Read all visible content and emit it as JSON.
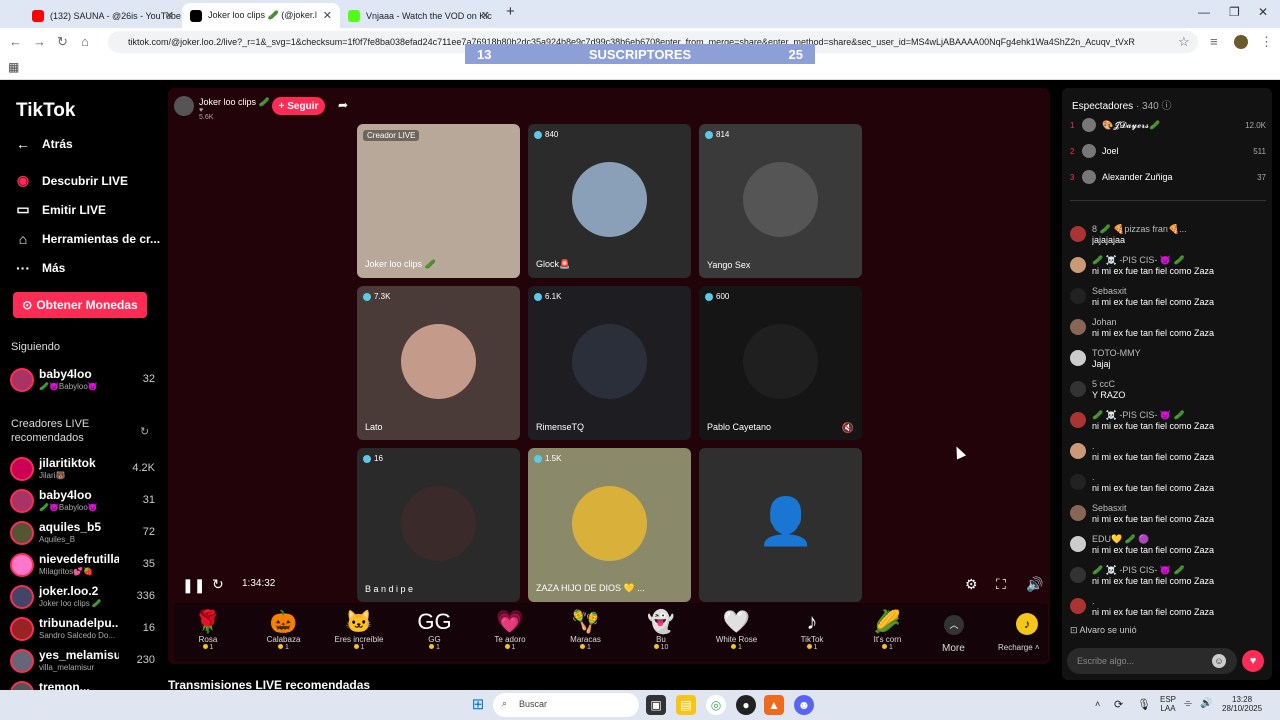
{
  "browser": {
    "tabs": [
      {
        "title": "(132) SAUNA - @26is - YouTube",
        "color": "#ff0000"
      },
      {
        "title": "Joker loo clips 🥒 (@joker.l",
        "color": "#000000"
      },
      {
        "title": "Vnjaaa - Watch the VOD on Kic",
        "color": "#53fc18"
      }
    ],
    "url": "tiktok.com/@joker.loo.2/live?_r=1&_svg=1&checksum=1f0f7fe8ba038efad24c711ee7a76918b80b2dc35a924b8e9c7d99c38b6eb6708enter_from_merge=share&enter_method=share&sec_user_id=MS4wLjABAAAA00NqFg4ehk1Wa4ShZ2n_Acuqv_tVxR"
  },
  "overlay": {
    "left": "13",
    "label": "SUSCRIPTORES",
    "right": "25"
  },
  "sidebar": {
    "logo": "TikTok",
    "nav": [
      {
        "label": "Atrás",
        "icon": "back-arrow-icon"
      },
      {
        "label": "Descubrir LIVE",
        "icon": "live-icon"
      },
      {
        "label": "Emitir LIVE",
        "icon": "camera-icon"
      },
      {
        "label": "Herramientas de cr...",
        "icon": "home-icon"
      },
      {
        "label": "Más",
        "icon": "more-dots-icon"
      }
    ],
    "coins_button": "Obtener Monedas",
    "following_label": "Siguiendo",
    "following": [
      {
        "name": "baby4loo",
        "sub": "🥒😈Babyloo😈",
        "count": "32"
      }
    ],
    "recommended_label": "Creadores LIVE recomendados",
    "recommended": [
      {
        "name": "jilaritiktok",
        "sub": "Jilari🐻",
        "count": "4.2K",
        "color": "#c05"
      },
      {
        "name": "baby4loo",
        "sub": "🥒😈Babyloo😈",
        "count": "31",
        "color": "#a36"
      },
      {
        "name": "aquiles_b5",
        "sub": "Aquiles_B",
        "count": "72",
        "color": "#553"
      },
      {
        "name": "nievedefrutilla",
        "sub": "Milagritos💕🍓",
        "count": "35",
        "color": "#f7c"
      },
      {
        "name": "joker.loo.2",
        "sub": "Joker loo clips 🥒",
        "count": "336",
        "color": "#446"
      },
      {
        "name": "tribunadelpu...",
        "sub": "Sandro Salcedo Do...",
        "count": "16",
        "color": "#922"
      },
      {
        "name": "yes_melamisur",
        "sub": "villa_melamisur",
        "count": "230",
        "color": "#667"
      },
      {
        "name": "tremon...",
        "sub": "",
        "count": "",
        "color": "#555"
      }
    ]
  },
  "host": {
    "name": "Joker loo clips 🥒",
    "likes": "5.6K",
    "follow": "+ Seguir"
  },
  "tiles": [
    {
      "badge": "Creador LIVE",
      "name": "Joker loo clips 🥒",
      "bg": "#b8a89a",
      "circle": ""
    },
    {
      "badge": "840",
      "name": "Glock🚨",
      "bg": "#2b2b2b",
      "circle": "#8aa0b8"
    },
    {
      "badge": "814",
      "name": "Yango Sex",
      "bg": "#3a3a3a",
      "circle": "#555"
    },
    {
      "badge": "7.3K",
      "name": "Lato",
      "bg": "#4a3a38",
      "circle": "#c49a8a"
    },
    {
      "badge": "6.1K",
      "name": "RimenseTQ",
      "bg": "#1e1e22",
      "circle": "#2a2f3a"
    },
    {
      "badge": "600",
      "name": "Pablo Cayetano",
      "bg": "#151515",
      "circle": "#1f1f1f"
    },
    {
      "badge": "16",
      "name": "B a n d i p e",
      "bg": "#2a2a2a",
      "circle": "#3a2a2a"
    },
    {
      "badge": "1.5K",
      "name": "ZAZA HIJO DE DIOS 💛 ...",
      "bg": "#8a8a6a",
      "circle": "#d9b13a"
    },
    {
      "badge": "",
      "name": "",
      "bg": "#2f2f2f",
      "circle": ""
    }
  ],
  "player": {
    "time": "1:34:32"
  },
  "gifts": [
    {
      "name": "Rosa",
      "price": "1",
      "icon": "🌹"
    },
    {
      "name": "Calabaza",
      "price": "1",
      "icon": "🎃"
    },
    {
      "name": "Eres increíble",
      "price": "1",
      "icon": "🐱"
    },
    {
      "name": "GG",
      "price": "1",
      "icon": "GG"
    },
    {
      "name": "Te adoro",
      "price": "1",
      "icon": "💗"
    },
    {
      "name": "Maracas",
      "price": "1",
      "icon": "🪇"
    },
    {
      "name": "Bu",
      "price": "10",
      "icon": "👻"
    },
    {
      "name": "White Rose",
      "price": "1",
      "icon": "🤍"
    },
    {
      "name": "TikTok",
      "price": "1",
      "icon": "♪"
    },
    {
      "name": "It's corn",
      "price": "1",
      "icon": "🌽"
    }
  ],
  "gift_more": "More",
  "recharge": "Recharge",
  "chat": {
    "viewers_label": "Espectadores",
    "viewers_count": "340",
    "top_viewers": [
      {
        "rank": "1",
        "name": "🎨𝓙𝓓𝓪𝔂𝓮𝓻𝓼🥒",
        "score": "12.0K"
      },
      {
        "rank": "2",
        "name": "Joel",
        "score": "511"
      },
      {
        "rank": "3",
        "name": "Alexander Zuñiga",
        "score": "37"
      }
    ],
    "messages": [
      {
        "user": "8 🥒 🍕pizzas fran🍕...",
        "text": "jajajajaa"
      },
      {
        "user": "🥒 ☠️ -PIS CIS- 👿 🥒",
        "text": "ni mi ex fue tan fiel como Zaza"
      },
      {
        "user": "Sebasxit",
        "text": "ni mi ex fue tan fiel como Zaza"
      },
      {
        "user": "Johan",
        "text": "ni mi ex fue tan fiel como Zaza"
      },
      {
        "user": "TOTO-MMY",
        "text": "Jajaj"
      },
      {
        "user": "5 ccC",
        "text": "Y RAZO"
      },
      {
        "user": "🥒 ☠️ -PIS CIS- 👿 🥒",
        "text": "ni mi ex fue tan fiel como Zaza"
      },
      {
        "user": ".",
        "text": "ni mi ex fue tan fiel como Zaza"
      },
      {
        "user": ".",
        "text": "ni mi ex fue tan fiel como Zaza"
      },
      {
        "user": "Sebasxit",
        "text": "ni mi ex fue tan fiel como Zaza"
      },
      {
        "user": "EDU💛 🥒 🟣",
        "text": "ni mi ex fue tan fiel como Zaza"
      },
      {
        "user": "🥒 ☠️ -PIS CIS- 👿 🥒",
        "text": "ni mi ex fue tan fiel como Zaza"
      },
      {
        "user": ".",
        "text": "ni mi ex fue tan fiel como Zaza"
      }
    ],
    "joined": "Alvaro  se unió",
    "input_placeholder": "Escribe algo..."
  },
  "below_stage_heading": "Transmisiones LIVE recomendadas",
  "taskbar": {
    "search": "Buscar",
    "lang": "ESP",
    "region": "LAA",
    "time": "13:28",
    "date": "28/10/2025"
  }
}
